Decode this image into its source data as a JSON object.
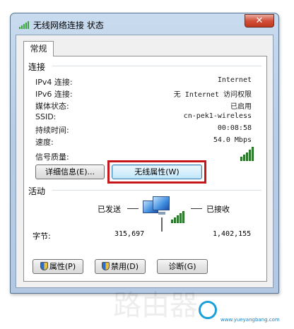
{
  "window": {
    "title": "无线网络连接 状态",
    "close_glyph": "✕"
  },
  "tabs": [
    {
      "label": "常规"
    }
  ],
  "connection": {
    "heading": "连接",
    "rows": [
      {
        "label": "IPv4 连接:",
        "value": "Internet"
      },
      {
        "label": "IPv6 连接:",
        "value": "无 Internet 访问权限"
      },
      {
        "label": "媒体状态:",
        "value": "已启用"
      },
      {
        "label": "SSID:",
        "value": "cn-pek1-wireless"
      },
      {
        "label": "持续时间:",
        "value": "00:08:58"
      },
      {
        "label": "速度:",
        "value": "54.0 Mbps"
      }
    ],
    "signal_label": "信号质量:",
    "signal_bars": 5,
    "details_button": "详细信息(E)...",
    "wireless_props_button": "无线属性(W)"
  },
  "activity": {
    "heading": "活动",
    "sent_label": "已发送",
    "received_label": "已接收",
    "bytes_label": "字节:",
    "bytes_sent": "315,697",
    "bytes_received": "1,402,155"
  },
  "buttons": {
    "properties": "属性(P)",
    "disable": "禁用(D)",
    "diagnose": "诊断(G)"
  },
  "watermark": {
    "brand": "路由器",
    "site": "www.yueyangbang.com"
  },
  "colors": {
    "highlight": "#c4161b",
    "signal": "#2c9a2c",
    "close": "#c03820"
  }
}
